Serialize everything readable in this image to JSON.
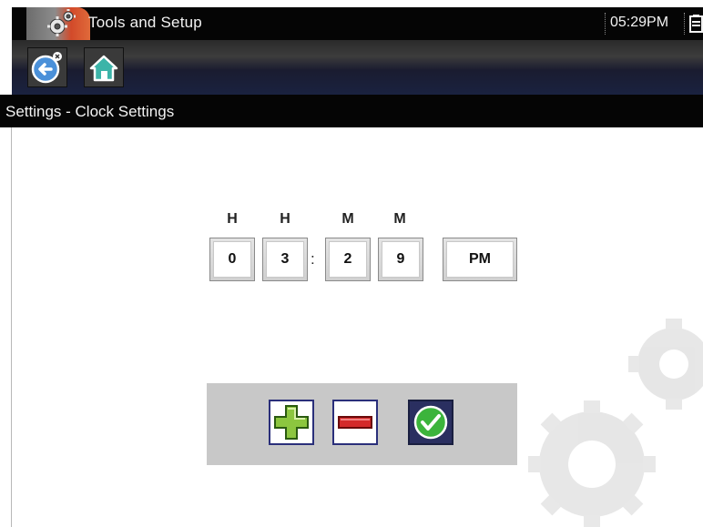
{
  "titlebar": {
    "title": "Tools and Setup",
    "time": "05:29PM",
    "app_icon": "tools-gear-icon",
    "battery_icon": "battery-icon"
  },
  "toolbar": {
    "back_icon": "back-icon",
    "home_icon": "home-icon"
  },
  "breadcrumb": {
    "text": "Settings - Clock Settings"
  },
  "clock": {
    "headers": [
      "H",
      "H",
      "M",
      "M"
    ],
    "digits": [
      "0",
      "3",
      "2",
      "9"
    ],
    "separator": ":",
    "ampm": "PM"
  },
  "controls": {
    "plus_icon": "plus-icon",
    "minus_icon": "minus-icon",
    "accept_icon": "checkmark-icon"
  },
  "colors": {
    "bar_background": "#050505",
    "panel": "#c8c8c8",
    "plus_green": "#8cc63f",
    "minus_red": "#d42a2a",
    "accept_green": "#3cb43c"
  }
}
